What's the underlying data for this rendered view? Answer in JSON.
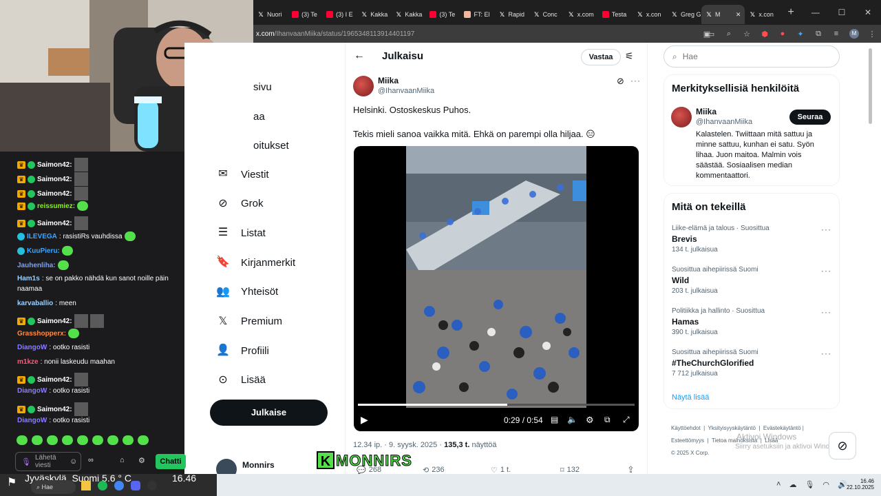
{
  "browser": {
    "tabs": [
      {
        "label": "Nuori",
        "icon": "x-icon",
        "kind": "x"
      },
      {
        "label": "(3) Te",
        "icon": "youtube-icon",
        "kind": "yt"
      },
      {
        "label": "(3) I E",
        "icon": "youtube-icon",
        "kind": "yt"
      },
      {
        "label": "Kakka",
        "icon": "x-icon",
        "kind": "x"
      },
      {
        "label": "Kakka",
        "icon": "x-icon",
        "kind": "x"
      },
      {
        "label": "(3) Te",
        "icon": "youtube-icon",
        "kind": "yt"
      },
      {
        "label": "FT: El",
        "icon": "ft-icon",
        "kind": "ft"
      },
      {
        "label": "Rapid",
        "icon": "x-icon",
        "kind": "x"
      },
      {
        "label": "Conc",
        "icon": "x-icon",
        "kind": "x"
      },
      {
        "label": "x.com",
        "icon": "x-icon",
        "kind": "x"
      },
      {
        "label": "Testa",
        "icon": "youtube-icon",
        "kind": "yt"
      },
      {
        "label": "x.con",
        "icon": "x-icon",
        "kind": "x"
      },
      {
        "label": "Greg G",
        "icon": "x-icon",
        "kind": "x"
      },
      {
        "label": "M",
        "icon": "x-icon",
        "kind": "x",
        "active": true
      },
      {
        "label": "x.con",
        "icon": "x-icon",
        "kind": "x"
      }
    ],
    "new_tab": "+",
    "url_host": "x.com",
    "url_path": "/IhanvaanMiika/status/1965348113914401197",
    "profile_initial": "M"
  },
  "nav": {
    "partial_items": [
      "sivu",
      "aa",
      "oitukset"
    ],
    "items": [
      {
        "label": "Viestit",
        "icon": "envelope-icon",
        "glyph": "✉"
      },
      {
        "label": "Grok",
        "icon": "grok-icon",
        "glyph": "⊘"
      },
      {
        "label": "Listat",
        "icon": "list-icon",
        "glyph": "☰"
      },
      {
        "label": "Kirjanmerkit",
        "icon": "bookmark-icon",
        "glyph": "🔖"
      },
      {
        "label": "Yhteisöt",
        "icon": "communities-icon",
        "glyph": "👥"
      },
      {
        "label": "Premium",
        "icon": "x-logo-icon",
        "glyph": "𝕏"
      },
      {
        "label": "Profiili",
        "icon": "person-icon",
        "glyph": "👤"
      },
      {
        "label": "Lisää",
        "icon": "more-circle-icon",
        "glyph": "⊙"
      }
    ],
    "post_button": "Julkaise",
    "account_name": "Monnirs",
    "account_handle": "@..."
  },
  "post_header": {
    "title": "Julkaisu",
    "reply_button": "Vastaa"
  },
  "tweet": {
    "author_name": "Miika",
    "author_handle": "@IhanvaanMiika",
    "line1": "Helsinki. Ostoskeskus Puhos.",
    "line2": "Tekis mieli sanoa vaikka mitä. Ehkä on parempi olla hiljaa. 😑",
    "video_time": "0:29 / 0:54",
    "video_progress": 0.54,
    "timestamp": "12.34 ip. · 9. syysk. 2025 · ",
    "views": "135,3 t.",
    "views_label": " näyttöä",
    "stats": {
      "replies": "268",
      "reposts": "236",
      "likes": "1 t.",
      "bookmarks": "132"
    }
  },
  "search": {
    "placeholder": "Hae"
  },
  "relevant": {
    "title": "Merkityksellisiä henkilöitä",
    "name": "Miika",
    "handle": "@IhanvaanMiika",
    "follow": "Seuraa",
    "bio": "Kalastelen. Twiittaan mitä sattuu ja minne sattuu, kunhan ei satu. Syön lihaa. Juon maitoa. Malmin vois säästää. Sosiaalisen median kommentaattori."
  },
  "trends": {
    "title": "Mitä on tekeillä",
    "items": [
      {
        "category": "Liike-elämä ja talous · Suosittua",
        "name": "Brevis",
        "count": "134 t. julkaisua"
      },
      {
        "category": "Suosittua aihepiirissä Suomi",
        "name": "Wild",
        "count": "203 t. julkaisua"
      },
      {
        "category": "Politiikka ja hallinto · Suosittua",
        "name": "Hamas",
        "count": "390 t. julkaisua"
      },
      {
        "category": "Suosittua aihepiirissä Suomi",
        "name": "#TheChurchGlorified",
        "count": "7 712 julkaisua"
      }
    ],
    "show_more": "Näytä lisää"
  },
  "footer": {
    "links": [
      "Käyttöehdot",
      "Yksityisyyskäytäntö",
      "Evästekäytäntö",
      "Esteettömyys",
      "Tietoa mainoksista",
      "Lisää"
    ],
    "copyright": "© 2025 X Corp.",
    "watermark_title": "Aktivoi Windows",
    "watermark_sub": "Siirry asetuksiin ja aktivoi Windows."
  },
  "chat": {
    "messages": [
      {
        "user": "Saimon42:",
        "color": "#ffffff",
        "badge": "crown",
        "text": "",
        "emotes": 1,
        "gemotes": 0
      },
      {
        "user": "Saimon42:",
        "color": "#ffffff",
        "badge": "crown",
        "text": "",
        "emotes": 1,
        "gemotes": 0
      },
      {
        "user": "Saimon42:",
        "color": "#ffffff",
        "badge": "crown",
        "text": "",
        "emotes": 1,
        "gemotes": 0
      },
      {
        "user": "reissumiez:",
        "color": "#7cfc00",
        "badge": "crown",
        "text": "",
        "emotes": 0,
        "gemotes": 1
      },
      {
        "user": "Saimon42:",
        "color": "#ffffff",
        "badge": "crown",
        "text": "",
        "emotes": 1,
        "gemotes": 0
      },
      {
        "user": "ILEVEGA",
        "color": "#3ea6ff",
        "badge": "cyan",
        "text": ": rasistiRs vauhdissa",
        "emotes": 0,
        "gemotes": 1
      },
      {
        "user": "KuuPieru:",
        "color": "#3ea6ff",
        "badge": "cyan",
        "text": "",
        "emotes": 0,
        "gemotes": 1
      },
      {
        "user": "Jauhenliha:",
        "color": "#7aa2ff",
        "badge": "",
        "text": "",
        "emotes": 0,
        "gemotes": 1
      },
      {
        "user": "Ham1s",
        "color": "#9ad0ff",
        "badge": "",
        "text": ": se on pakko nähdä kun sanot noille päin",
        "emotes": 0,
        "gemotes": 0
      },
      {
        "user": "",
        "color": "#ffffff",
        "badge": "",
        "text": "naamaa",
        "emotes": 0,
        "gemotes": 0
      },
      {
        "user": "karvaballio",
        "color": "#9ad0ff",
        "badge": "",
        "text": ": meen",
        "emotes": 0,
        "gemotes": 0
      },
      {
        "user": "Saimon42:",
        "color": "#ffffff",
        "badge": "crown",
        "text": "",
        "emotes": 2,
        "gemotes": 0
      },
      {
        "user": "Grasshopperx:",
        "color": "#ff8c42",
        "badge": "",
        "text": "",
        "emotes": 0,
        "gemotes": 1
      },
      {
        "user": "DiangoW",
        "color": "#8a7dff",
        "badge": "",
        "text": ": ootko rasisti",
        "emotes": 0,
        "gemotes": 0
      },
      {
        "user": "m1kze",
        "color": "#ff5a7a",
        "badge": "",
        "text": ": nonii laskeudu maahan",
        "emotes": 0,
        "gemotes": 0
      },
      {
        "user": "Saimon42:",
        "color": "#ffffff",
        "badge": "crown",
        "text": "",
        "emotes": 1,
        "gemotes": 0
      },
      {
        "user": "DiangoW",
        "color": "#8a7dff",
        "badge": "",
        "text": ": ootko rasisti",
        "emotes": 0,
        "gemotes": 0
      },
      {
        "user": "Saimon42:",
        "color": "#ffffff",
        "badge": "crown",
        "text": "",
        "emotes": 1,
        "gemotes": 0
      },
      {
        "user": "DiangoW",
        "color": "#8a7dff",
        "badge": "",
        "text": ": ootko rasisti",
        "emotes": 0,
        "gemotes": 0
      }
    ],
    "input_placeholder": "Lähetä viesti",
    "send_button": "Chatti"
  },
  "overlay": {
    "channel_name": "MONNIRS",
    "logo_letter": "K"
  },
  "taskbar": {
    "weather": "Jyväskylä, Suomi  5.6 ° C",
    "weather_time": "16.46",
    "search": "Hae",
    "clock_time": "16.46",
    "clock_date": "22.10.2025"
  }
}
